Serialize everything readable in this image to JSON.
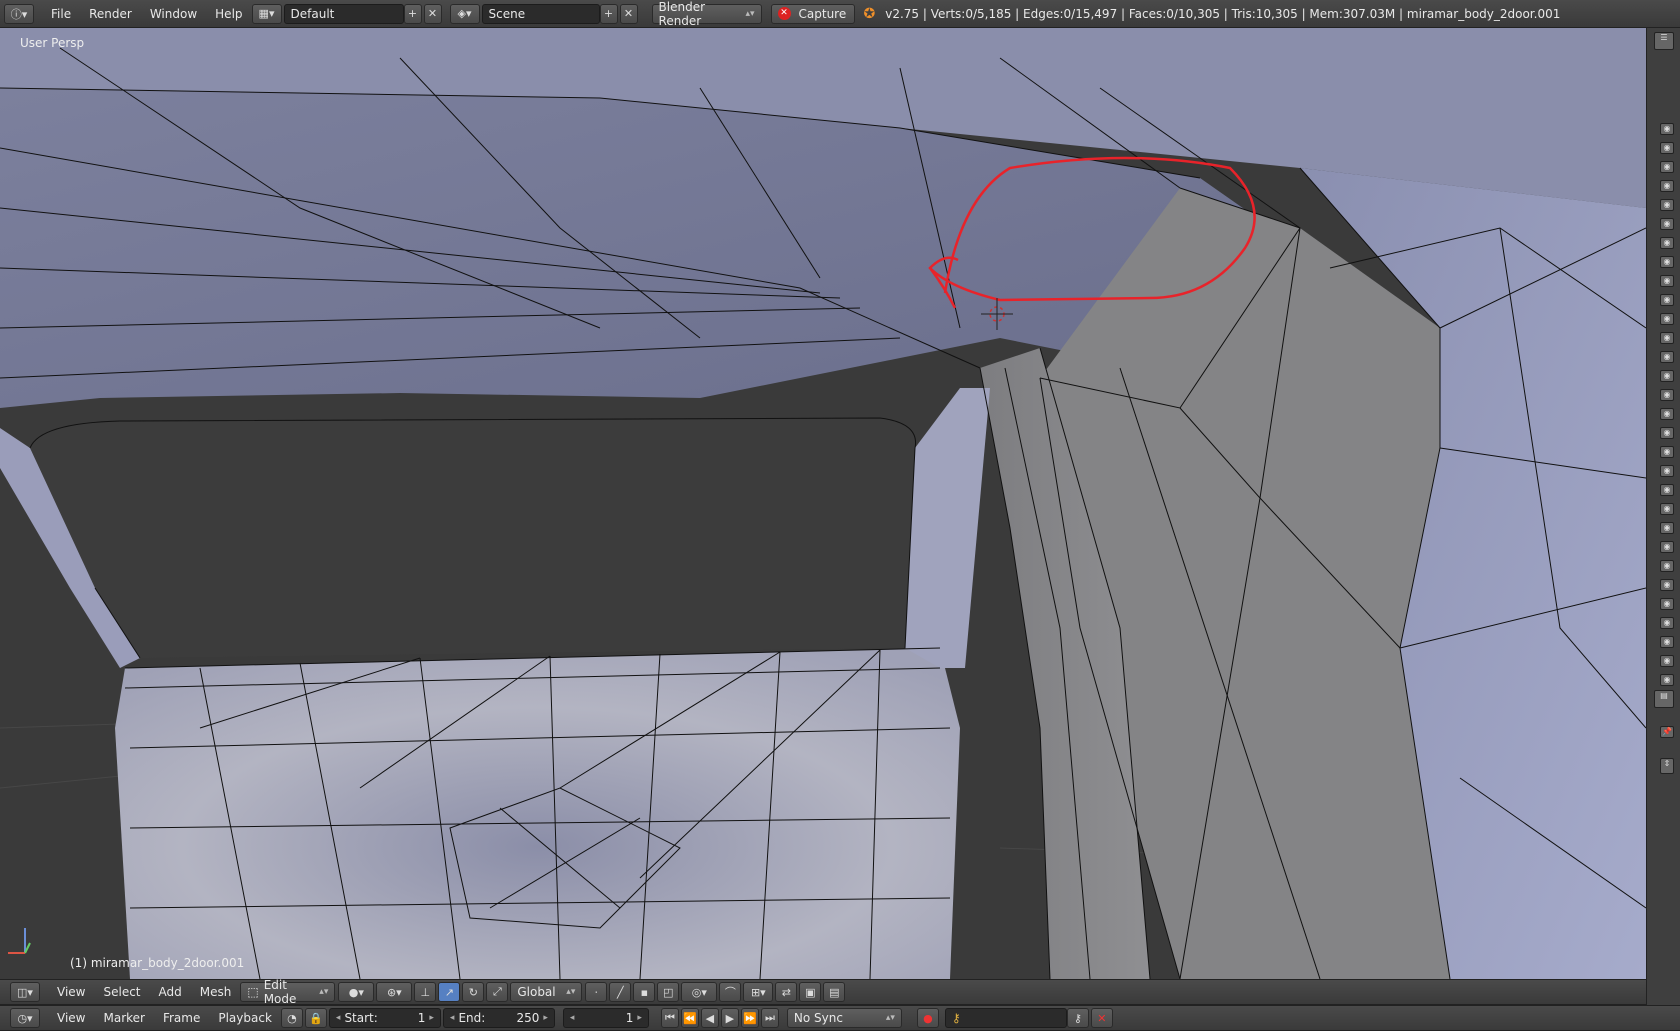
{
  "topbar": {
    "menus": [
      "File",
      "Render",
      "Window",
      "Help"
    ],
    "screen_layout": "Default",
    "scene": "Scene",
    "render_engine": "Blender Render",
    "capture_label": "Capture",
    "stats": "v2.75 | Verts:0/5,185 | Edges:0/15,497 | Faces:0/10,305 | Tris:10,305 | Mem:307.03M | miramar_body_2door.001"
  },
  "viewport": {
    "view_label": "User Persp",
    "object_label": "(1) miramar_body_2door.001"
  },
  "viewport_header": {
    "menus": [
      "View",
      "Select",
      "Add",
      "Mesh"
    ],
    "mode": "Edit Mode",
    "orientation": "Global"
  },
  "timeline": {
    "menus": [
      "View",
      "Marker",
      "Frame",
      "Playback"
    ],
    "start_label": "Start:",
    "start_value": "1",
    "end_label": "End:",
    "end_value": "250",
    "current_frame": "1",
    "sync": "No Sync"
  },
  "colors": {
    "annotation_circle": "#e8232a",
    "mesh_blue": "#7a7f9e",
    "mesh_gray": "#8c8c8c",
    "background": "#3a3a3a"
  }
}
